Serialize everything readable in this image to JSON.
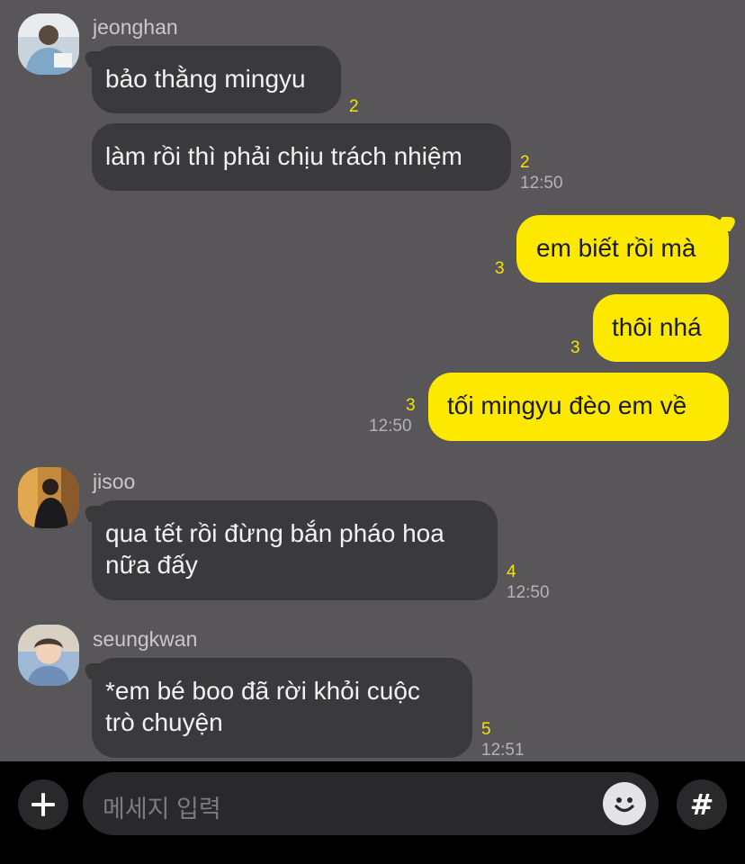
{
  "messages": [
    {
      "sender": "jeonghan",
      "text": "bảo thằng mingyu",
      "count": "2"
    },
    {
      "text": "làm rồi thì phải chịu trách nhiệm",
      "count": "2",
      "time": "12:50"
    },
    {
      "from": "me",
      "text": "em biết rồi mà",
      "count": "3"
    },
    {
      "from": "me",
      "text": "thôi nhá",
      "count": "3"
    },
    {
      "from": "me",
      "text": "tối mingyu đèo em về",
      "count": "3",
      "time": "12:50"
    },
    {
      "sender": "jisoo",
      "text_line1": "qua tết rồi đừng bắn pháo hoa",
      "text_line2": "nữa đấy",
      "count": "4",
      "time": "12:50"
    },
    {
      "sender": "seungkwan",
      "text_line1": "*em bé boo đã rời khỏi cuộc",
      "text_line2": "trò chuyện",
      "count": "5",
      "time": "12:51"
    }
  ],
  "input": {
    "placeholder": "메세지 입력",
    "add_icon": "plus-icon",
    "emoji_icon": "smiley-icon",
    "hashtag_icon": "#"
  },
  "colors": {
    "background": "#585659",
    "incoming_bubble": "#3a3a3c",
    "outgoing_bubble": "#fde900",
    "unread_count": "#f5e400"
  }
}
